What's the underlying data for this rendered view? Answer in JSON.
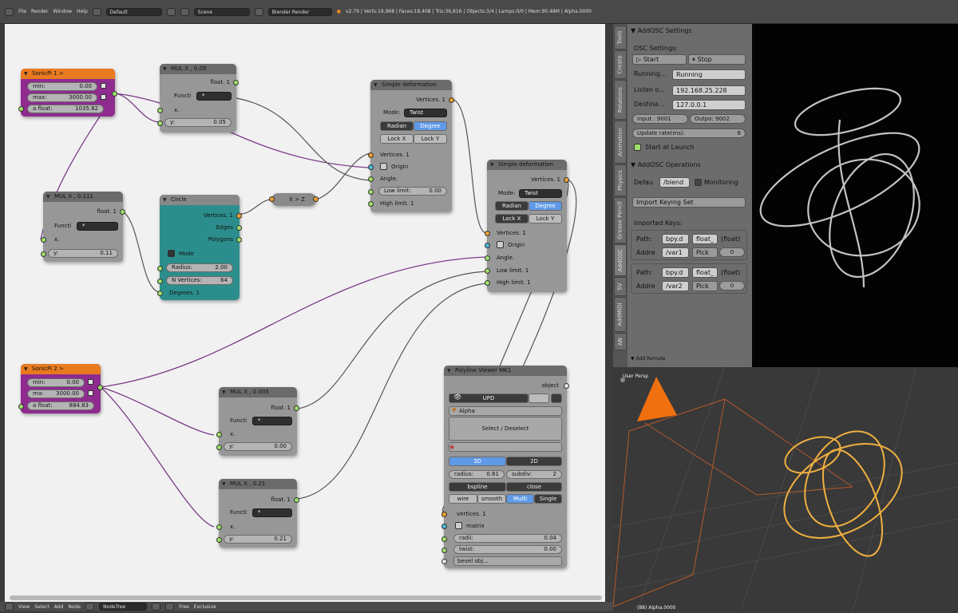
{
  "topbar": {
    "menus": [
      "File",
      "Render",
      "Window",
      "Help"
    ],
    "layout": "Default",
    "scene": "Scene",
    "engine": "Blender Render",
    "stats": "v2.79 | Verts:19,968 | Faces:18,408 | Tris:36,816 | Objects:3/4 | Lamps:0/0 | Mem:90.48M | Alpha.0000"
  },
  "nodes": {
    "sonicpi1": {
      "title": "SonicPi 1 >",
      "min_label": "min:",
      "min_value": "0.00",
      "max_label": "max:",
      "max_value": "3000.00",
      "afloat_label": "a float:",
      "afloat_value": "1035.82"
    },
    "mul1": {
      "title": "MUL X , 0.05",
      "out": "float. 1",
      "func_label": "Functi",
      "func_value": "*",
      "x": "x.",
      "y_label": "y:",
      "y_value": "0.05"
    },
    "mul2": {
      "title": "MUL X , 0.111",
      "out": "float. 1",
      "func_label": "Functi",
      "func_value": "*",
      "x": "x.",
      "y_label": "y:",
      "y_value": "0.11"
    },
    "circle": {
      "title": "Circle",
      "out1": "Vertices. 1",
      "out2": "Edges",
      "out3": "Polygons",
      "mode": "Mode",
      "radius_label": "Radius:",
      "radius_value": "2.00",
      "nverts_label": "N Vertices:",
      "nverts_value": "64",
      "degrees": "Degrees. 1"
    },
    "xz": {
      "title": "X > Z"
    },
    "sdef1": {
      "title": "Simple deformation",
      "out": "Vertices. 1",
      "mode_label": "Mode:",
      "mode_value": "Twist",
      "radian": "Radian",
      "degree": "Degree",
      "lockx": "Lock X",
      "locky": "Lock Y",
      "in1": "Vertices. 1",
      "in2": "Origin",
      "in3": "Angle.",
      "low_label": "Low limit:",
      "low_value": "0.00",
      "high": "High limit. 1"
    },
    "sdef2": {
      "title": "Simple deformation",
      "out": "Vertices. 1",
      "mode_label": "Mode:",
      "mode_value": "Twist",
      "radian": "Radian",
      "degree": "Degree",
      "lockx": "Lock X",
      "locky": "Lock Y",
      "in1": "Vertices. 1",
      "in2": "Origin",
      "in3": "Angle.",
      "in4": "Low limit. 1",
      "high": "High limit. 1"
    },
    "sonicpi2": {
      "title": "SonicPi 2 >",
      "min_label": "min:",
      "min_value": "0.00",
      "max_label": "ma:",
      "max_value": "3000.00",
      "afloat_label": "a float:",
      "afloat_value": "884.83"
    },
    "mul3": {
      "title": "MUL X , 0.005",
      "out": "float. 1",
      "func_label": "Functi",
      "func_value": "*",
      "x": "x.",
      "y_label": "y:",
      "y_value": "0.00"
    },
    "mul4": {
      "title": "MUL X , 0.21",
      "out": "float. 1",
      "func_label": "Functi",
      "func_value": "*",
      "x": "x.",
      "y_label": "y:",
      "y_value": "0.21"
    },
    "polyline": {
      "title": "Polyline Viewer MK1",
      "object": "object",
      "upd": "UPD",
      "alpha": "Alpha",
      "select": "Select / Deselect",
      "b3d": "3D",
      "b2d": "2D",
      "radius_label": "radius:",
      "radius_value": "0.61",
      "subdiv_label": "subdiv:",
      "subdiv_value": "2",
      "bspline": "bspline",
      "close": "close",
      "wire": "wire",
      "smooth": "smooth",
      "multi": "Multi",
      "single": "Single",
      "vertices": "vertices. 1",
      "matrix": "matrix",
      "radii_label": "radii:",
      "radii_value": "0.04",
      "twist_label": "twist:",
      "twist_value": "0.00",
      "bevel": "bevel obj..."
    }
  },
  "bottombar": {
    "menus": [
      "View",
      "Select",
      "Add",
      "Node"
    ],
    "tree": "NodeTree",
    "extra": "Free",
    "extra2": "Exclusive"
  },
  "tabs": [
    "Tools",
    "Create",
    "Relations",
    "Animation",
    "Physics",
    "Grease Pencil",
    "AddOSC",
    "SV",
    "AddMIDI",
    "AN"
  ],
  "panel": {
    "settings_title": "AddOSC Settings",
    "osc_settings": "OSC Settings:",
    "start": "Start",
    "stop": "Stop",
    "running_label": "Running...",
    "running_value": "Running",
    "listen_label": "Listen o...",
    "listen_value": "192.168.25.228",
    "dest_label": "Destina...",
    "dest_value": "127.0.0.1",
    "input": "Input : 9001",
    "output": "Outpo: 9002",
    "rate_label": "Update rate(ms):",
    "rate_value": "8",
    "start_launch": "Start at Launch",
    "ops_title": "AddOSC Operations",
    "defau_label": "Defau",
    "defau_value": "/blend",
    "monitoring": "Monitoring",
    "import_keying": "Import Keying Set",
    "imported_keys": "Imported Keys:",
    "keys": [
      {
        "path_label": "Path:",
        "path": "bpy.d",
        "type": "float_",
        "kind": "(float)",
        "addr_label": "Addre",
        "addr": "/var1",
        "pick": "Pick",
        "idx": "0"
      },
      {
        "path_label": "Path:",
        "path": "bpy.d",
        "type": "float_",
        "kind": "(float)",
        "addr_label": "Addre",
        "addr": "/var2",
        "pick": "Pick",
        "idx": "0"
      }
    ],
    "add_reroute": "Add Reroute"
  },
  "viewport": {
    "label": "User Persp",
    "footer": "(88) Alpha.0000"
  },
  "colors": {
    "purple": "#8f2b8f",
    "teal": "#2c8e8c",
    "orange": "#f08010",
    "blue": "#5f9ae8",
    "wire": "#7a3c88"
  }
}
